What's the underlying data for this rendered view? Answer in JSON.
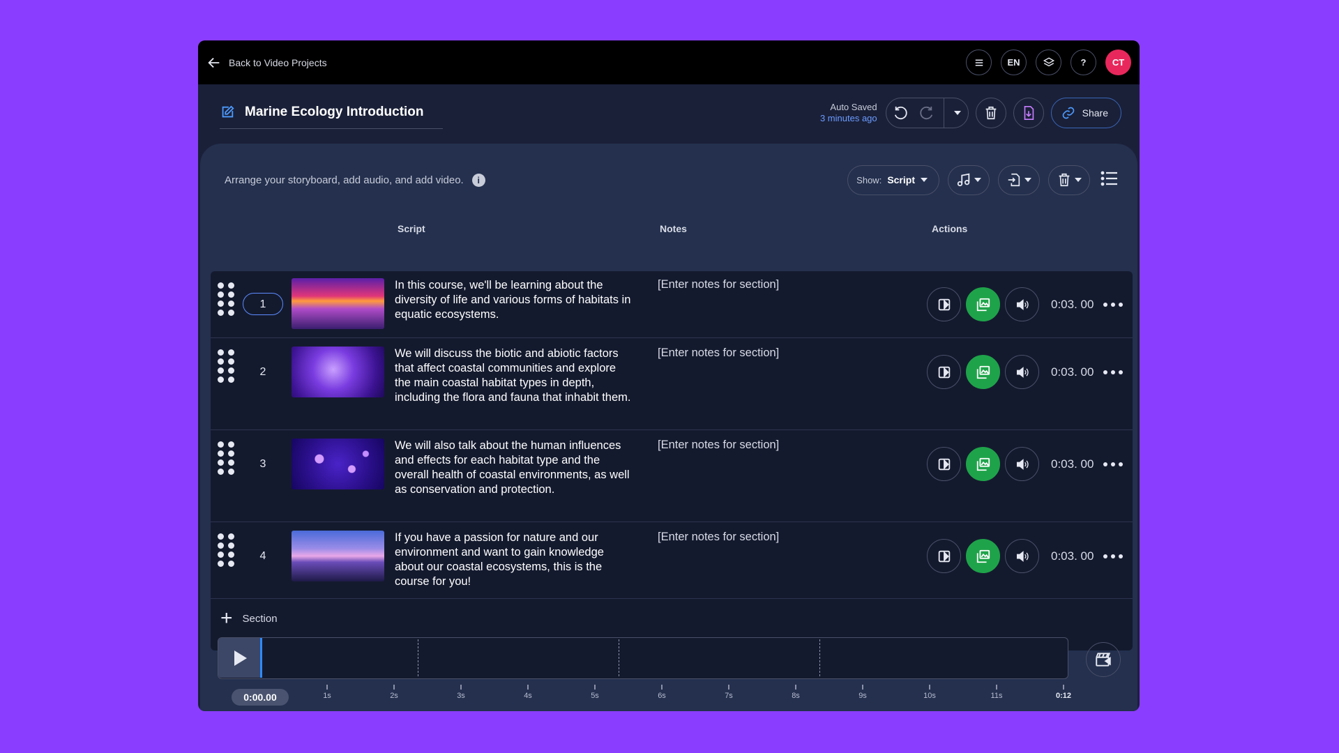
{
  "topbar": {
    "back_label": "Back to Video Projects",
    "language": "EN",
    "help": "?",
    "avatar_initials": "CT",
    "avatar_color": "#e8285c"
  },
  "project": {
    "title": "Marine Ecology Introduction",
    "autosave_label": "Auto Saved",
    "autosave_time": "3 minutes ago",
    "share_label": "Share"
  },
  "toolbar": {
    "hint": "Arrange your storyboard, add audio, and add video.",
    "info_glyph": "i",
    "show_label": "Show:",
    "show_value": "Script"
  },
  "columns": {
    "script": "Script",
    "notes": "Notes",
    "actions": "Actions"
  },
  "sections": [
    {
      "number": "1",
      "script": "In this course, we'll be learning about the diversity of life and various forms of habitats in equatic ecosystems.",
      "notes": "[Enter notes for section]",
      "duration": "0:03. 00",
      "thumbnail": "purple-sunset-beach"
    },
    {
      "number": "2",
      "script": "We will discuss the biotic and abiotic factors that affect coastal communities and explore the main coastal habitat types in depth, including the flora and fauna that inhabit them.",
      "notes": "[Enter notes for section]",
      "duration": "0:03. 00",
      "thumbnail": "purple-fish"
    },
    {
      "number": "3",
      "script": "We will also talk about the human influences and effects for each habitat type and the overall health of coastal environments, as well as conservation and protection.",
      "notes": "[Enter notes for section]",
      "duration": "0:03. 00",
      "thumbnail": "jellyfish"
    },
    {
      "number": "4",
      "script": "If you have a passion for nature and our environment and want to gain knowledge about our coastal ecosystems, this is the course for you!",
      "notes": "[Enter notes for section]",
      "duration": "0:03. 00",
      "thumbnail": "twilight-lake"
    }
  ],
  "add_section_label": "Section",
  "timeline": {
    "current_time": "0:00.00",
    "ticks": [
      "1s",
      "2s",
      "3s",
      "4s",
      "5s",
      "6s",
      "7s",
      "8s",
      "9s",
      "10s",
      "11s",
      "0:12"
    ]
  },
  "colors": {
    "background": "#8b3dff",
    "accent_green": "#1fa34a",
    "accent_blue": "#5b8cff"
  }
}
